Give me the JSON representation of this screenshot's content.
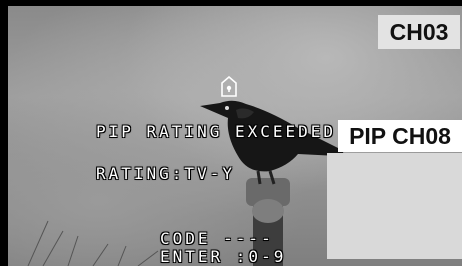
{
  "main_channel": {
    "label": "CH03"
  },
  "pip": {
    "label": "PIP CH08"
  },
  "parental_lock": {
    "message": "PIP RATING EXCEEDED",
    "rating": "RATING:TV-Y",
    "code_prompt": "CODE ----",
    "enter_prompt": "ENTER :0-9",
    "icon": "lock-icon"
  },
  "colors": {
    "badge_background": "#e3e3e3",
    "pip_window": "#d9d9d9",
    "osd_text": "#ffffff"
  }
}
